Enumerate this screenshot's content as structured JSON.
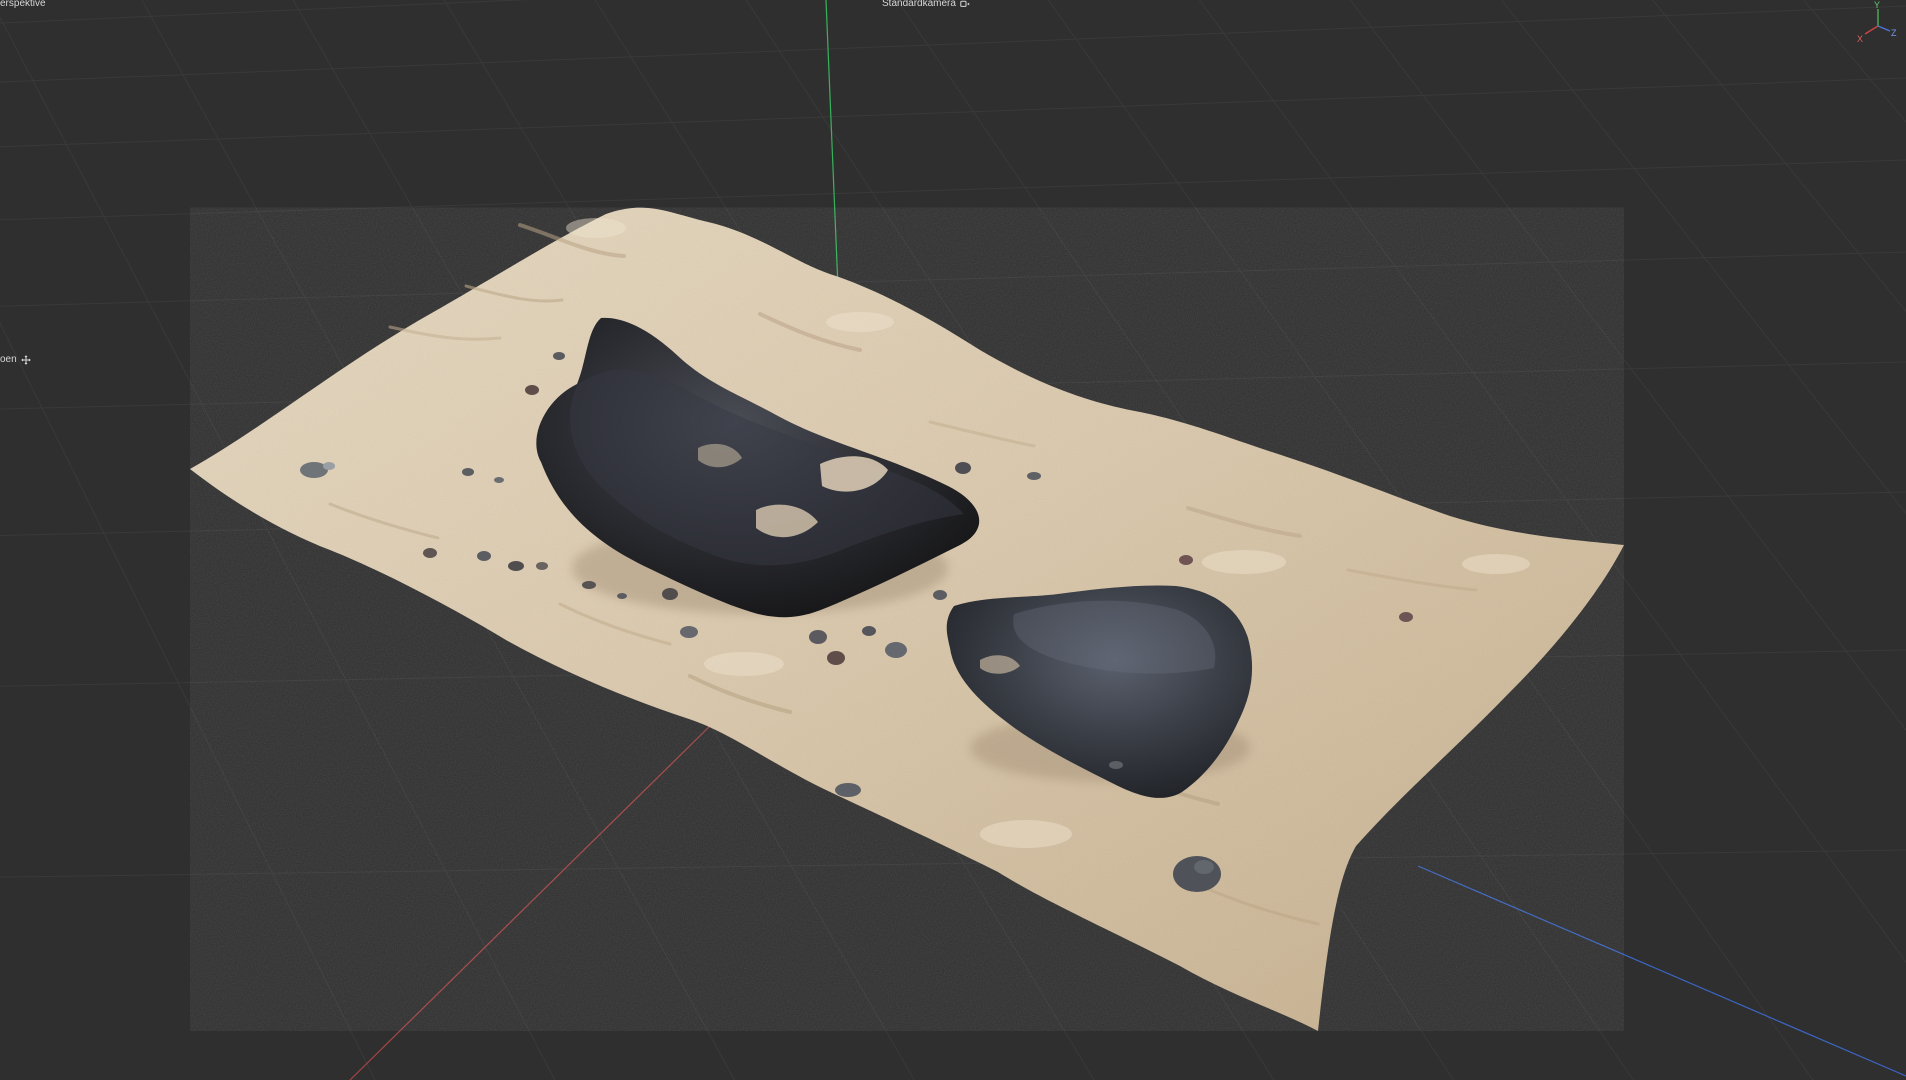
{
  "viewport": {
    "view_name": "erspektive",
    "camera_name": "Standardkamera",
    "side_label": "oen"
  },
  "gizmo": {
    "x_label": "X",
    "y_label": "Y",
    "z_label": "Z"
  },
  "icons": {
    "camera": "camera-move-icon",
    "side": "move-cross-icon"
  },
  "colors": {
    "background": "#2f2f2f",
    "grid": "#3c3c3c",
    "x_axis": "#d04444",
    "y_axis": "#40c060",
    "z_axis": "#4f76d8",
    "sand_light": "#dfcfb5",
    "sand_mid": "#cdb89a",
    "rock_dark": "#2b2d31"
  }
}
